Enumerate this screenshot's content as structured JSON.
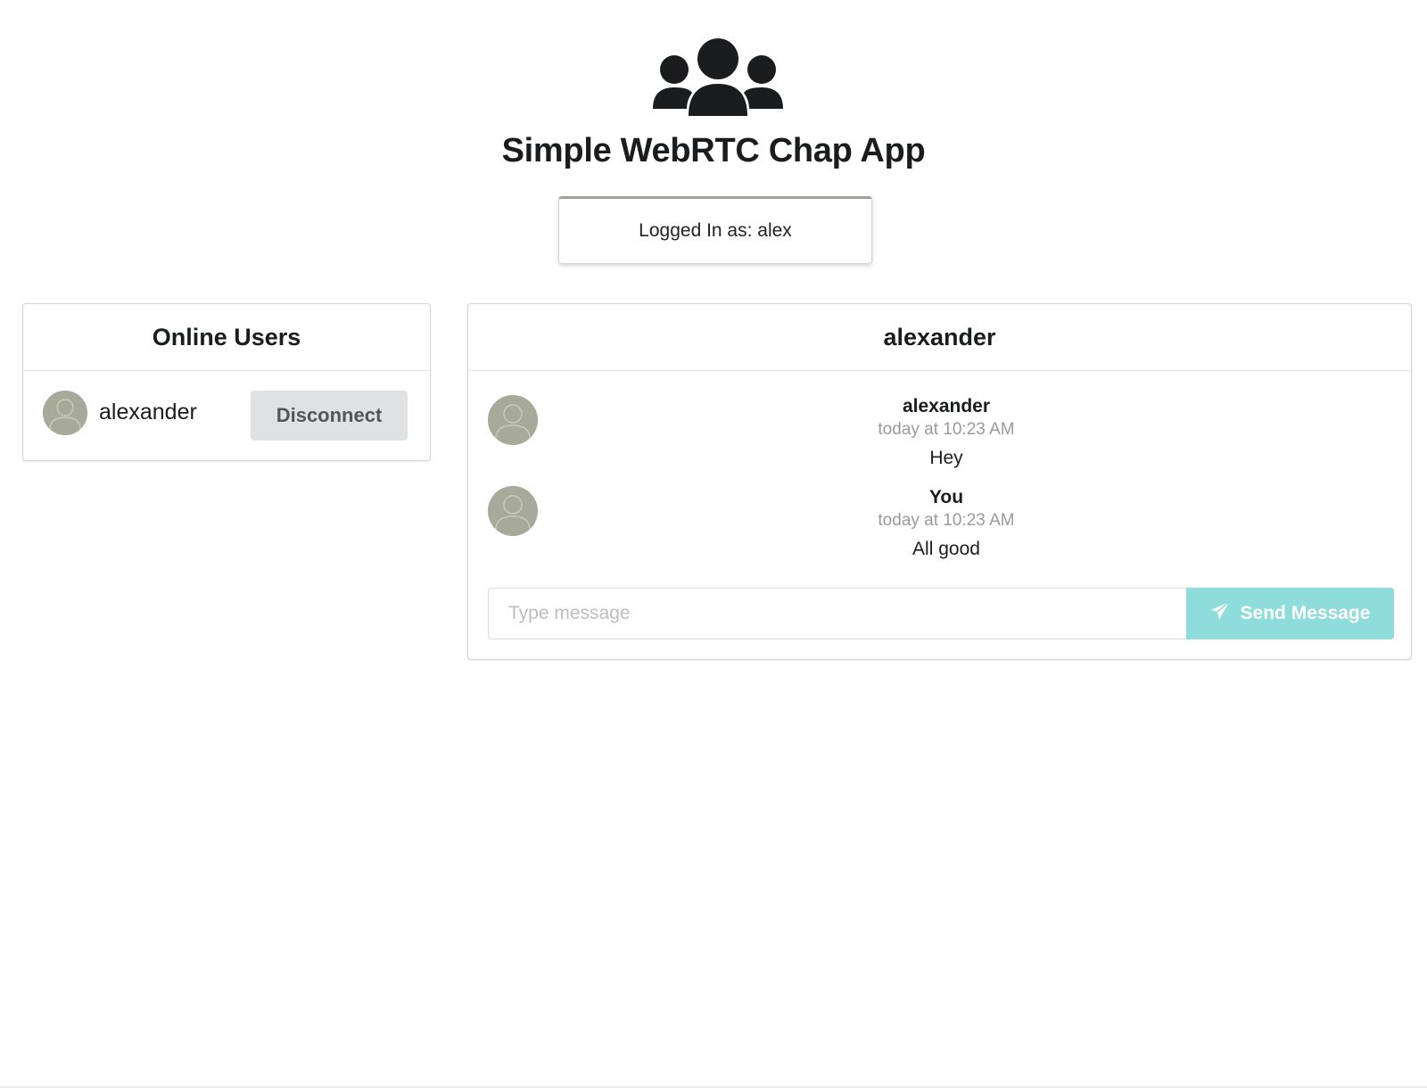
{
  "header": {
    "icon": "users-icon",
    "title": "Simple WebRTC Chap App",
    "login_status": "Logged In as: alex"
  },
  "online_users": {
    "title": "Online Users",
    "users": [
      {
        "name": "alexander",
        "avatar": "user-avatar-icon",
        "action_label": "Disconnect"
      }
    ]
  },
  "chat": {
    "title": "alexander",
    "messages": [
      {
        "author": "alexander",
        "time": "today at 10:23 AM",
        "text": "Hey",
        "avatar": "user-avatar-icon"
      },
      {
        "author": "You",
        "time": "today at 10:23 AM",
        "text": "All good",
        "avatar": "user-avatar-icon"
      }
    ],
    "input": {
      "value": "",
      "placeholder": "Type message"
    },
    "send_label": "Send Message",
    "send_icon": "paper-plane-icon"
  },
  "colors": {
    "send_button": "#8fdcdc",
    "disconnect_button": "#e0e1e2",
    "avatar": "#a7aa98"
  }
}
